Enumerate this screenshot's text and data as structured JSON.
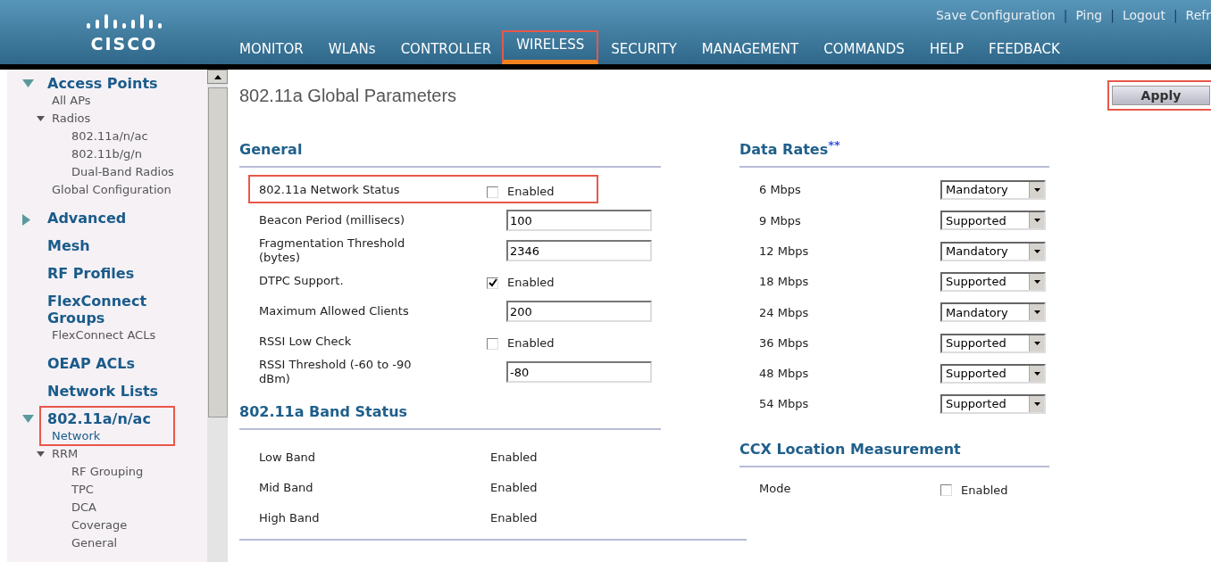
{
  "header": {
    "logo": "CISCO",
    "top_links": [
      {
        "kind": "link",
        "text": "Save Configuration"
      },
      {
        "kind": "separator",
        "text": "|"
      },
      {
        "kind": "link",
        "text": "Ping"
      },
      {
        "kind": "separator",
        "text": "|"
      },
      {
        "kind": "link",
        "text": "Logout"
      },
      {
        "kind": "separator",
        "text": "|"
      },
      {
        "kind": "link",
        "text": "Refr"
      }
    ],
    "nav": [
      {
        "label": "MONITOR",
        "selected": false,
        "highlighted": false
      },
      {
        "label": "WLANs",
        "selected": false,
        "highlighted": false
      },
      {
        "label": "CONTROLLER",
        "selected": false,
        "highlighted": false
      },
      {
        "label": "WIRELESS",
        "selected": true,
        "highlighted": true
      },
      {
        "label": "SECURITY",
        "selected": false,
        "highlighted": false
      },
      {
        "label": "MANAGEMENT",
        "selected": false,
        "highlighted": false
      },
      {
        "label": "COMMANDS",
        "selected": false,
        "highlighted": false
      },
      {
        "label": "HELP",
        "selected": false,
        "highlighted": false
      },
      {
        "label": "FEEDBACK",
        "selected": false,
        "highlighted": false
      }
    ]
  },
  "sidebar": {
    "sections": [
      {
        "label": "Access Points",
        "expanded": true,
        "highlighted": false,
        "children": [
          {
            "label": "All APs",
            "selected": false
          },
          {
            "label": "Radios",
            "selected": false,
            "expanded": true,
            "children": [
              {
                "label": "802.11a/n/ac",
                "selected": false
              },
              {
                "label": "802.11b/g/n",
                "selected": false
              },
              {
                "label": "Dual-Band Radios",
                "selected": false
              }
            ]
          },
          {
            "label": "Global Configuration",
            "selected": false
          }
        ]
      },
      {
        "label": "Advanced",
        "expanded": false,
        "highlighted": false
      },
      {
        "label": "Mesh",
        "highlighted": false
      },
      {
        "label": "RF Profiles",
        "highlighted": false
      },
      {
        "label": "FlexConnect Groups",
        "highlighted": false,
        "children": [
          {
            "label": "FlexConnect ACLs",
            "selected": false
          }
        ]
      },
      {
        "label": "OEAP ACLs",
        "highlighted": false
      },
      {
        "label": "Network Lists",
        "highlighted": false
      },
      {
        "label": "802.11a/n/ac",
        "expanded": true,
        "highlighted": true,
        "children": [
          {
            "label": "Network",
            "selected": true
          },
          {
            "label": "RRM",
            "selected": false,
            "expanded": true,
            "children": [
              {
                "label": "RF Grouping",
                "selected": false
              },
              {
                "label": "TPC",
                "selected": false
              },
              {
                "label": "DCA",
                "selected": false
              },
              {
                "label": "Coverage",
                "selected": false
              },
              {
                "label": "General",
                "selected": false
              }
            ]
          }
        ]
      }
    ]
  },
  "page": {
    "title": "802.11a Global Parameters",
    "apply": {
      "label": "Apply",
      "highlighted": true
    }
  },
  "general": {
    "title": "General",
    "rows": [
      {
        "label": "802.11a Network Status",
        "kind": "checkbox",
        "checked": false,
        "text": "Enabled",
        "highlighted": true
      },
      {
        "label": "Beacon Period (millisecs)",
        "kind": "field",
        "value": "100",
        "highlighted": false
      },
      {
        "label": "Fragmentation Threshold (bytes)",
        "kind": "field",
        "value": "2346",
        "highlighted": false
      },
      {
        "label": "DTPC Support.",
        "kind": "checkbox",
        "checked": true,
        "text": "Enabled",
        "highlighted": false
      },
      {
        "label": "Maximum Allowed Clients",
        "kind": "field",
        "value": "200",
        "highlighted": false
      },
      {
        "label": "RSSI Low Check",
        "kind": "checkbox",
        "checked": false,
        "text": "Enabled",
        "highlighted": false
      },
      {
        "label": "RSSI Threshold (-60 to -90 dBm)",
        "kind": "field",
        "value": "-80",
        "highlighted": false
      }
    ]
  },
  "band_status": {
    "title": "802.11a Band Status",
    "rows": [
      {
        "label": "Low Band",
        "value": "Enabled"
      },
      {
        "label": "Mid Band",
        "value": "Enabled"
      },
      {
        "label": "High Band",
        "value": "Enabled"
      }
    ]
  },
  "data_rates": {
    "title": "Data Rates$^{**}$",
    "rows": [
      {
        "label": "6 Mbps",
        "value": "Mandatory"
      },
      {
        "label": "9 Mbps",
        "value": "Supported"
      },
      {
        "label": "12 Mbps",
        "value": "Mandatory"
      },
      {
        "label": "18 Mbps",
        "value": "Supported"
      },
      {
        "label": "24 Mbps",
        "value": "Mandatory"
      },
      {
        "label": "36 Mbps",
        "value": "Supported"
      },
      {
        "label": "48 Mbps",
        "value": "Supported"
      },
      {
        "label": "54 Mbps",
        "value": "Supported"
      }
    ]
  },
  "ccx": {
    "title": "CCX Location Measurement",
    "rows": [
      {
        "label": "Mode",
        "kind": "checkbox",
        "checked": false,
        "text": "Enabled"
      }
    ]
  }
}
